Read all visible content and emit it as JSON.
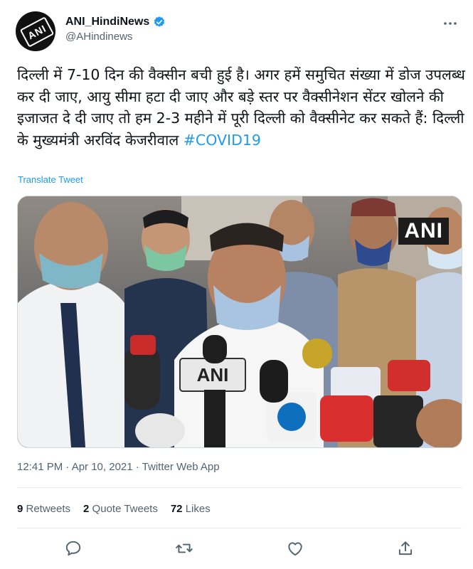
{
  "account": {
    "display_name": "ANI_HindiNews",
    "handle": "@AHindinews",
    "avatar_logo_text": "ANI",
    "verified_icon": "verified-badge-icon"
  },
  "tweet": {
    "text": "दिल्ली में 7-10 दिन की वैक्सीन बची हुई है। अगर हमें समुचित संख्या में डोज उपलब्ध कर दी जाए, आयु सीमा हटा दी जाए और बड़े स्तर पर वैक्सीनेशन सेंटर खोलने की इजाजत दे दी जाए तो हम 2-3 महीने में पूरी दिल्ली को वैक्सीनेट कर सकते हैं: दिल्ली के मुख्यमंत्री अरविंद केजरीवाल",
    "hashtag": "#COVID19",
    "translate_label": "Translate Tweet"
  },
  "media": {
    "watermark": "ANI",
    "mic_logo": "ANI"
  },
  "meta": {
    "timestamp": "12:41 PM · Apr 10, 2021 · Twitter Web App"
  },
  "stats": {
    "retweets_count": "9",
    "retweets_label": " Retweets",
    "quotes_count": "2",
    "quotes_label": " Quote Tweets",
    "likes_count": "72",
    "likes_label": " Likes"
  },
  "actions": [
    "reply-icon",
    "retweet-icon",
    "like-icon",
    "share-icon"
  ],
  "colors": {
    "accent": "#1d9bf0",
    "text": "#0f1419",
    "muted": "#536471"
  }
}
